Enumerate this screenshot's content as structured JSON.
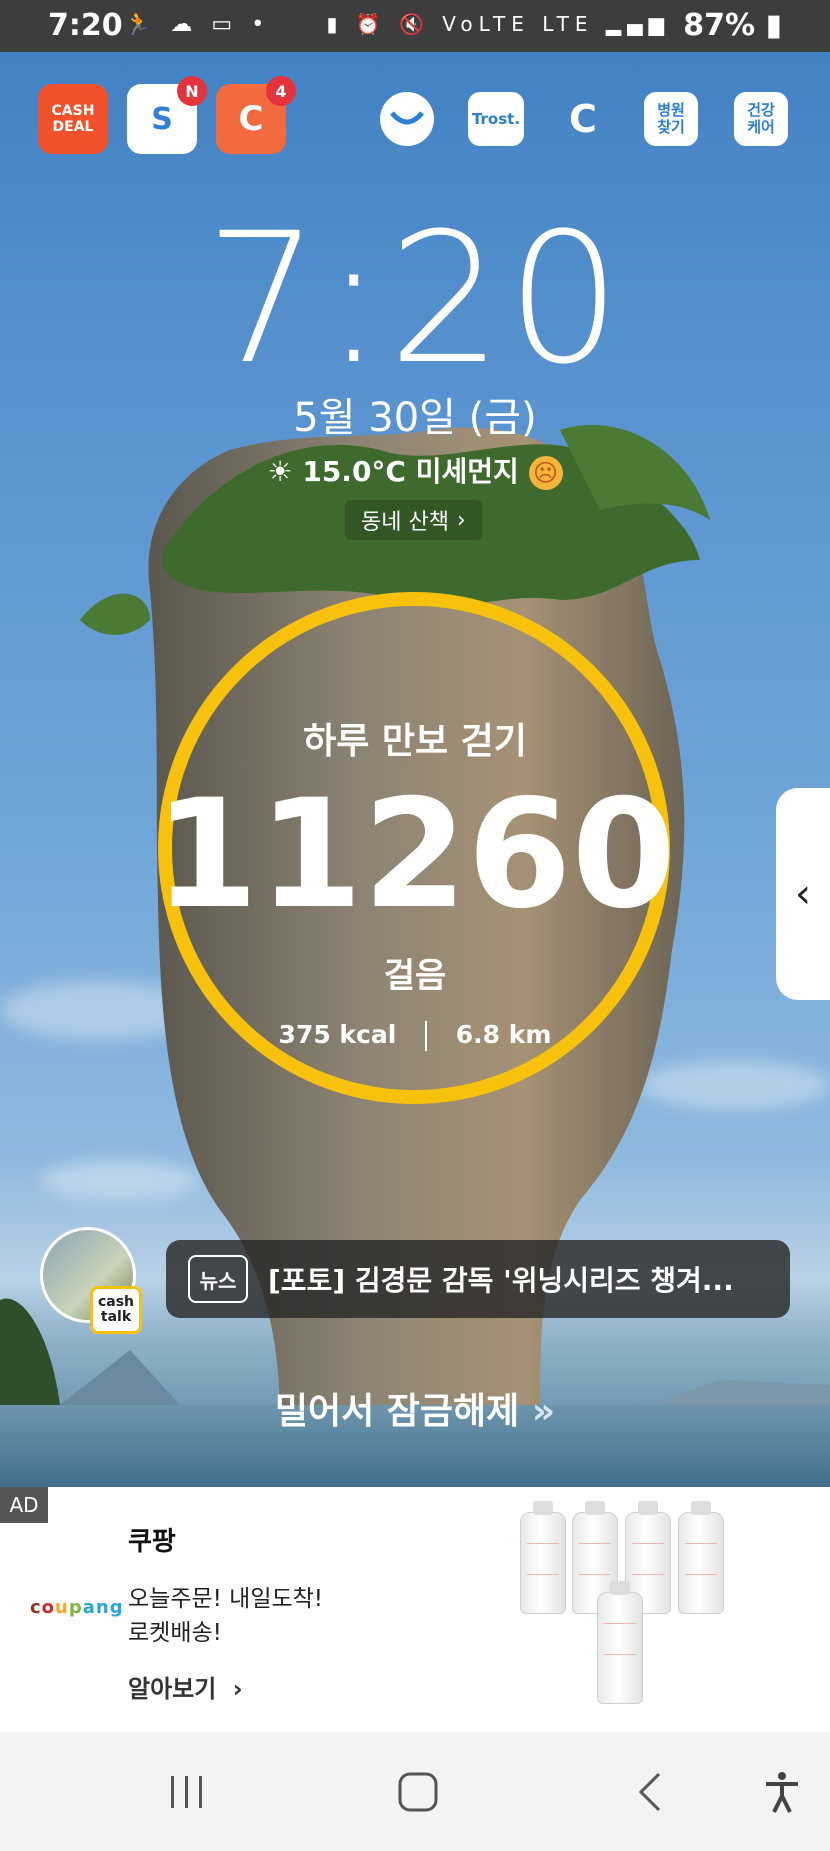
{
  "status_bar": {
    "time": "7:20",
    "battery": "87%",
    "left_icons": [
      "running-icon",
      "cloud-icon",
      "cash-icon",
      "dot-icon"
    ],
    "right_icons": [
      "battery-saver-icon",
      "alarm-icon",
      "mute-icon",
      "volte-icon",
      "lte-icon",
      "signal-icon",
      "battery-icon"
    ]
  },
  "shortcuts": {
    "cashdeal": "CASH\nDEAL",
    "app2_text": "S",
    "app2_badge": "N",
    "app3_text": "C",
    "app3_badge": "4",
    "trost": "Trost.",
    "hospital": "병원\n찾기",
    "health": "건강\n케어"
  },
  "clock": {
    "time": "7:20",
    "date": "5월 30일 (금)"
  },
  "weather": {
    "text": "15.0°C 미세먼지",
    "walk_link": "동네 산책"
  },
  "steps": {
    "title": "하루 만보 걷기",
    "count": "11260",
    "unit": "걸음",
    "kcal": "375 kcal",
    "distance": "6.8 km",
    "ring_color": "#f7c10c"
  },
  "news": {
    "cashtalk": "cash talk",
    "tag": "뉴스",
    "headline": "[포토] 김경문 감독 '위닝시리즈 챙겨..."
  },
  "unlock_text": "밀어서 잠금해제",
  "ad": {
    "label": "AD",
    "logo": "coupang",
    "brand": "쿠팡",
    "line1": "오늘주문! 내일도착!",
    "line2": "로켓배송!",
    "more": "알아보기"
  },
  "nav": [
    "recents-button",
    "home-button",
    "back-button",
    "accessibility-button"
  ]
}
